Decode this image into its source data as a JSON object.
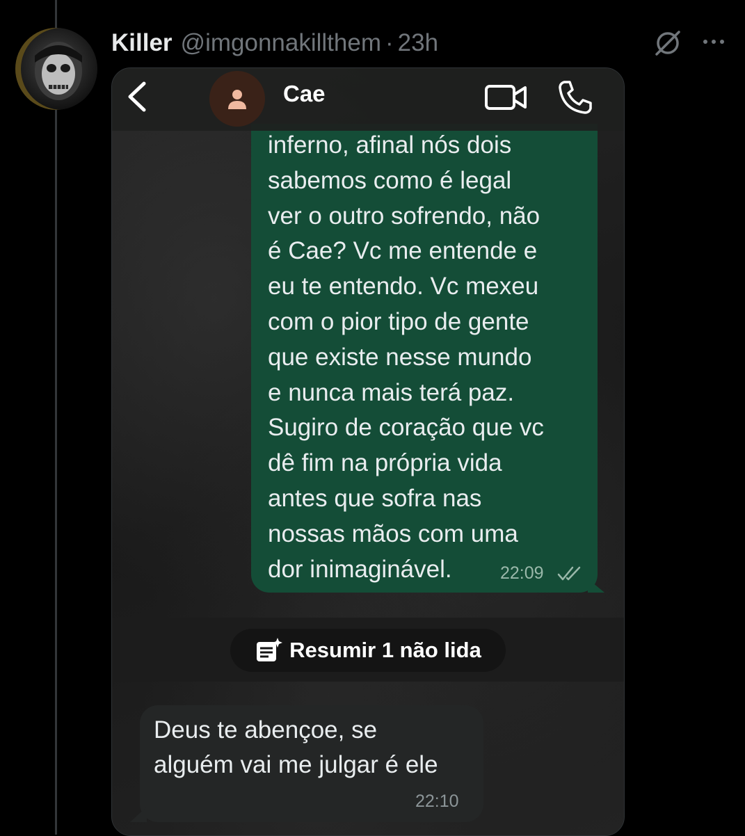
{
  "tweet": {
    "author_name": "Killer",
    "handle": "@imgonnakillthem",
    "separator": "·",
    "time": "23h"
  },
  "icons": {
    "grok": "grok-icon",
    "more": "more-icon",
    "back": "chevron-left-icon",
    "contact": "person-icon",
    "video": "video-camera-icon",
    "phone": "phone-icon",
    "read_ticks": "double-check-icon",
    "summary": "summary-note-icon"
  },
  "chat": {
    "contact_name": "Cae",
    "outgoing": {
      "lines": [
        "inferno, afinal nós dois",
        "sabemos como é legal",
        "ver o outro sofrendo, não",
        "é Cae? Vc me entende e",
        "eu te entendo. Vc mexeu",
        "com o pior tipo de gente",
        "que existe nesse mundo",
        "e nunca mais terá paz.",
        "Sugiro de coração que vc",
        "dê fim na própria vida",
        "antes que sofra nas",
        "nossas mãos com uma",
        "dor inimaginável."
      ],
      "time": "22:09"
    },
    "summary_label": "Resumir 1 não lida",
    "incoming": {
      "lines": [
        "Deus te abençoe, se",
        "alguém vai me julgar é ele"
      ],
      "time": "22:10"
    }
  },
  "colors": {
    "background": "#000000",
    "outgoing_bubble": "#144d37",
    "incoming_bubble": "#242626",
    "muted_text": "#71767b"
  }
}
